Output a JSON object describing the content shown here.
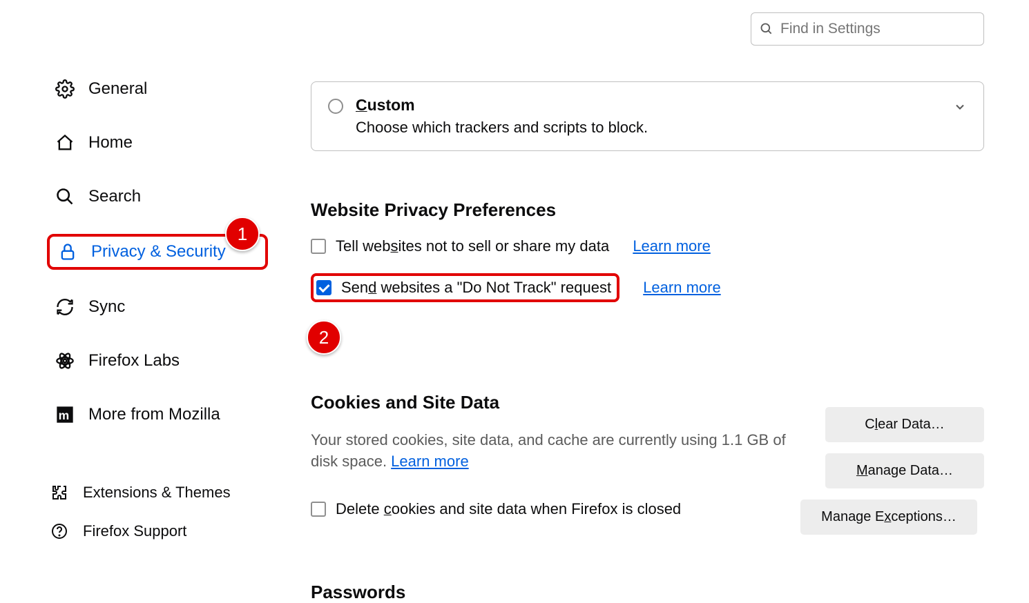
{
  "search": {
    "placeholder": "Find in Settings"
  },
  "sidebar": {
    "general": "General",
    "home": "Home",
    "search": "Search",
    "privacy": "Privacy & Security",
    "sync": "Sync",
    "labs": "Firefox Labs",
    "more": "More from Mozilla"
  },
  "bottom": {
    "extensions": "Extensions & Themes",
    "support": "Firefox Support"
  },
  "custom": {
    "title_prefix": "C",
    "title_rest": "ustom",
    "desc": "Choose which trackers and scripts to block."
  },
  "wpp": {
    "title": "Website Privacy Preferences",
    "tell_pre": "Tell web",
    "tell_u": "s",
    "tell_post": "ites not to sell or share my data",
    "learn": "Learn more",
    "dnt_pre": "Sen",
    "dnt_u": "d",
    "dnt_post": " websites a \"Do Not Track\" request"
  },
  "cookies": {
    "title": "Cookies and Site Data",
    "desc_pre": "Your stored cookies, site data, and cache are currently using 1.1 GB of disk space. ",
    "learn": "Learn more",
    "delete_pre": "Delete ",
    "delete_u": "c",
    "delete_post": "ookies and site data when Firefox is closed",
    "clear_pre": "C",
    "clear_u": "l",
    "clear_post": "ear Data…",
    "manage_u": "M",
    "manage_post": "anage Data…",
    "exc_pre": "Manage E",
    "exc_u": "x",
    "exc_post": "ceptions…"
  },
  "passwords": {
    "title": "Passwords"
  },
  "badges": {
    "b1": "1",
    "b2": "2"
  }
}
